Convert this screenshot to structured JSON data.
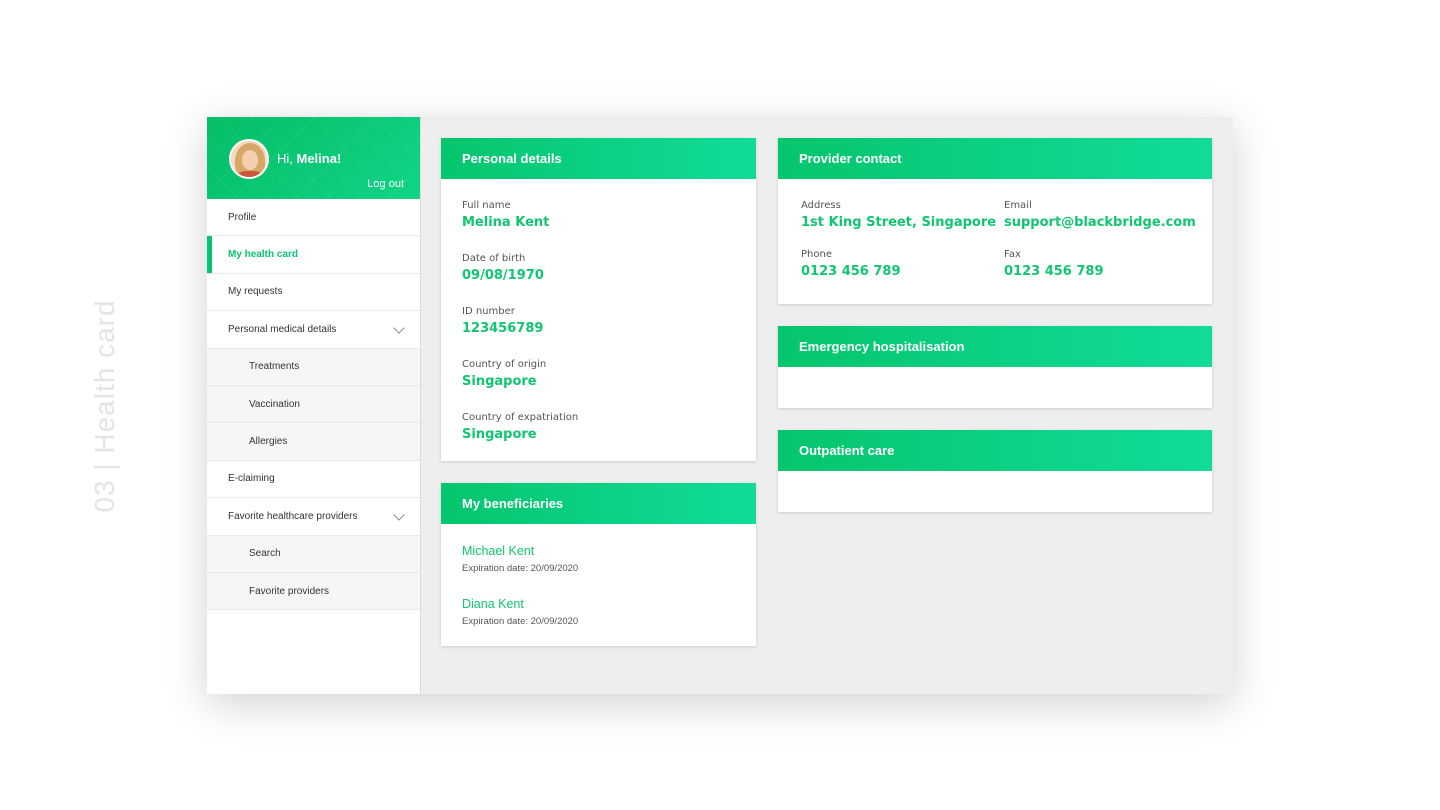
{
  "page_label": "03 | Health card",
  "sidebar": {
    "greeting_prefix": "Hi, ",
    "user_name": "Melina!",
    "logout_label": "Log out",
    "items": [
      {
        "label": "Profile"
      },
      {
        "label": "My health card"
      },
      {
        "label": "My requests"
      },
      {
        "label": "Personal medical details"
      },
      {
        "label": "Treatments"
      },
      {
        "label": "Vaccination"
      },
      {
        "label": "Allergies"
      },
      {
        "label": "E-claiming"
      },
      {
        "label": "Favorite healthcare providers"
      },
      {
        "label": "Search"
      },
      {
        "label": "Favorite providers"
      }
    ]
  },
  "personal_details": {
    "title": "Personal details",
    "fields": [
      {
        "label": "Full name",
        "value": "Melina Kent"
      },
      {
        "label": "Date of birth",
        "value": "09/08/1970"
      },
      {
        "label": "ID number",
        "value": "123456789"
      },
      {
        "label": "Country of origin",
        "value": "Singapore"
      },
      {
        "label": "Country of expatriation",
        "value": "Singapore"
      }
    ]
  },
  "beneficiaries": {
    "title": "My beneficiaries",
    "items": [
      {
        "name": "Michael Kent",
        "expiration": "Expiration date: 20/09/2020"
      },
      {
        "name": "Diana Kent",
        "expiration": "Expiration date: 20/09/2020"
      }
    ]
  },
  "provider_contact": {
    "title": "Provider contact",
    "fields": [
      {
        "label": "Address",
        "value": "1st King Street, Singapore"
      },
      {
        "label": "Email",
        "value": "support@blackbridge.com"
      },
      {
        "label": "Phone",
        "value": "0123 456 789"
      },
      {
        "label": "Fax",
        "value": "0123 456 789"
      }
    ]
  },
  "emergency": {
    "title": "Emergency hospitalisation"
  },
  "outpatient": {
    "title": "Outpatient care"
  },
  "colors": {
    "accent": "#09c372",
    "accent_light": "#10dc98",
    "background": "#eeeeee"
  }
}
